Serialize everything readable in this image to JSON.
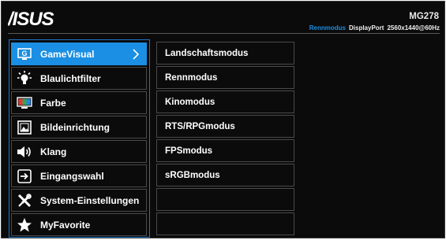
{
  "header": {
    "logo_text": "ASUS",
    "model": "MG278",
    "status": {
      "mode": "Rennmodus",
      "port": "DisplayPort",
      "resolution": "2560x1440@60Hz"
    }
  },
  "colors": {
    "accent": "#1a8fe3",
    "frame": "#1f74c4",
    "background": "#0b0b0b"
  },
  "main_menu": [
    {
      "label": "GameVisual",
      "icon": "gamevisual-icon",
      "selected": true
    },
    {
      "label": "Blaulichtfilter",
      "icon": "bulb-icon",
      "selected": false
    },
    {
      "label": "Farbe",
      "icon": "color-palette-icon",
      "selected": false
    },
    {
      "label": "Bildeinrichtung",
      "icon": "image-icon",
      "selected": false
    },
    {
      "label": "Klang",
      "icon": "speaker-icon",
      "selected": false
    },
    {
      "label": "Eingangswahl",
      "icon": "input-icon",
      "selected": false
    },
    {
      "label": "System-Einstellungen",
      "icon": "tools-icon",
      "selected": false
    },
    {
      "label": "MyFavorite",
      "icon": "star-icon",
      "selected": false
    }
  ],
  "submenu": [
    {
      "label": "Landschaftsmodus"
    },
    {
      "label": "Rennmodus"
    },
    {
      "label": "Kinomodus"
    },
    {
      "label": "RTS/RPGmodus"
    },
    {
      "label": "FPSmodus"
    },
    {
      "label": "sRGBmodus"
    },
    {
      "label": ""
    },
    {
      "label": ""
    }
  ]
}
